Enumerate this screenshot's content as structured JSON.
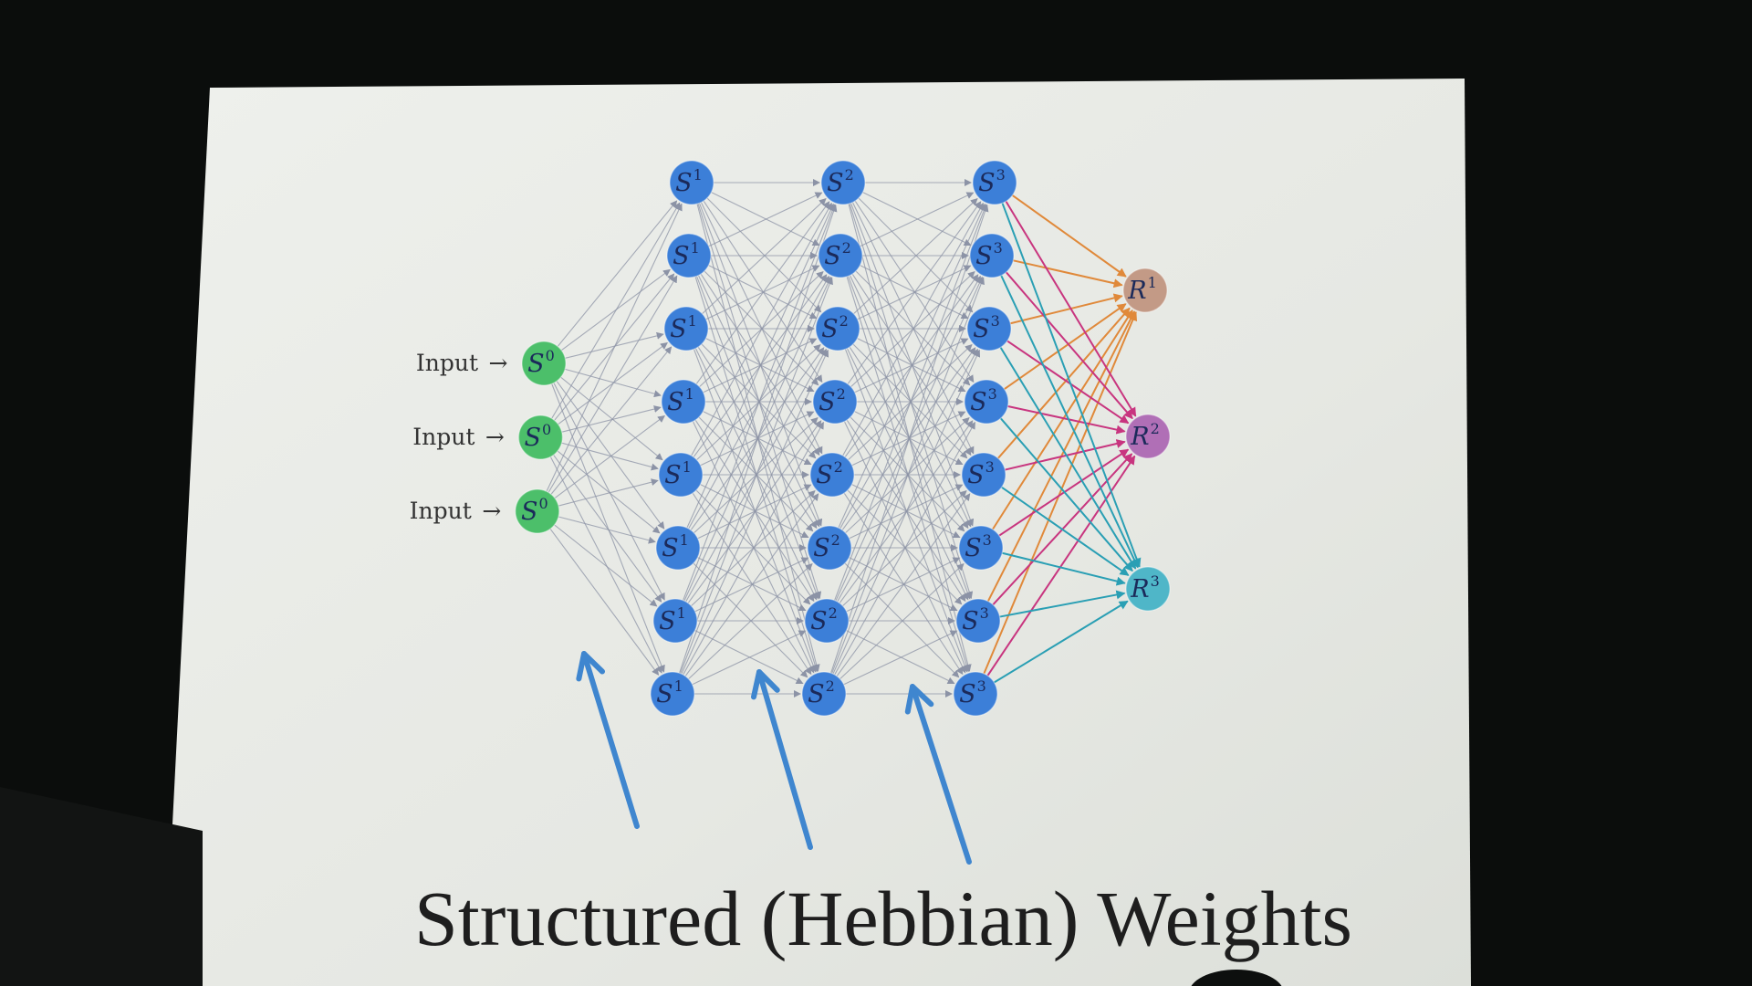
{
  "caption": "Structured (Hebbian) Weights",
  "inputs": {
    "label": "Input",
    "arrow": "→"
  },
  "layers": [
    {
      "symbol": "S",
      "sup": "0",
      "count": 3,
      "color": "#4cbf6a"
    },
    {
      "symbol": "S",
      "sup": "1",
      "count": 8,
      "color": "#3c7fd8"
    },
    {
      "symbol": "S",
      "sup": "2",
      "count": 8,
      "color": "#3c7fd8"
    },
    {
      "symbol": "S",
      "sup": "3",
      "count": 8,
      "color": "#3c7fd8"
    }
  ],
  "outputs": [
    {
      "symbol": "R",
      "sup": "1",
      "color": "#c39a86",
      "edge_color": "#e0893a"
    },
    {
      "symbol": "R",
      "sup": "2",
      "color": "#b06fb6",
      "edge_color": "#c8357f"
    },
    {
      "symbol": "R",
      "sup": "3",
      "color": "#4fb6c8",
      "edge_color": "#2a9fb4"
    }
  ],
  "colors": {
    "screen": "#e9ebe7",
    "hidden_edge": "#8c93a6",
    "pointer_arrow": "#3f86cf"
  }
}
